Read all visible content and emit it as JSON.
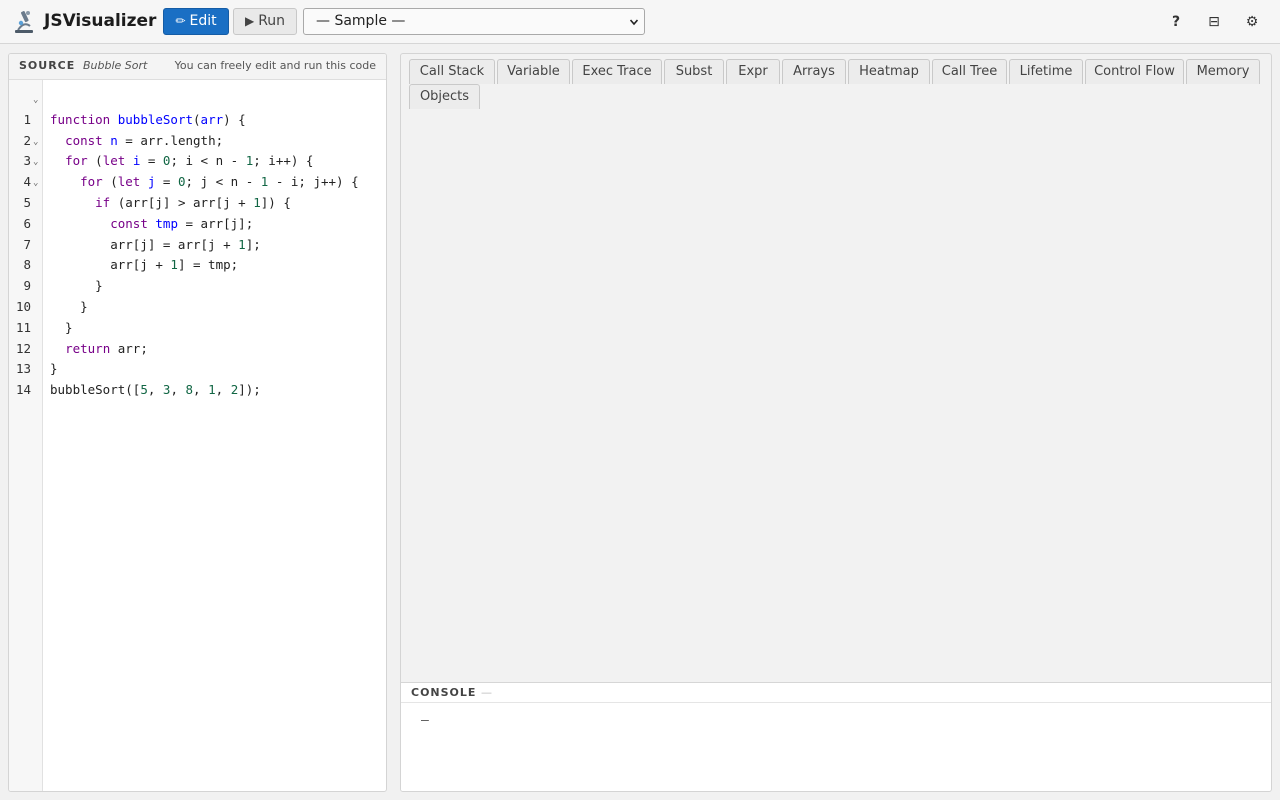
{
  "header": {
    "app_title": "JSVisualizer",
    "edit_label": "Edit",
    "run_label": "Run",
    "sample_selected": "— Sample —",
    "help_label": "?",
    "layout_label": "⊟",
    "settings_label": "⚙"
  },
  "icons": {
    "logo": "microscope-icon",
    "edit": "pencil-icon",
    "run": "play-icon"
  },
  "source": {
    "label": "SOURCE",
    "name": "Bubble Sort",
    "note": "You can freely edit and run this code",
    "lines": [
      {
        "n": "1",
        "fold": true
      },
      {
        "n": "2",
        "fold": false
      },
      {
        "n": "3",
        "fold": true
      },
      {
        "n": "4",
        "fold": true
      },
      {
        "n": "5",
        "fold": true
      },
      {
        "n": "6",
        "fold": false
      },
      {
        "n": "7",
        "fold": false
      },
      {
        "n": "8",
        "fold": false
      },
      {
        "n": "9",
        "fold": false
      },
      {
        "n": "10",
        "fold": false
      },
      {
        "n": "11",
        "fold": false
      },
      {
        "n": "12",
        "fold": false
      },
      {
        "n": "13",
        "fold": false
      },
      {
        "n": "14",
        "fold": false
      }
    ],
    "code": [
      "function bubbleSort(arr) {",
      "  const n = arr.length;",
      "  for (let i = 0; i < n - 1; i++) {",
      "    for (let j = 0; j < n - 1 - i; j++) {",
      "      if (arr[j] > arr[j + 1]) {",
      "        const tmp = arr[j];",
      "        arr[j] = arr[j + 1];",
      "        arr[j + 1] = tmp;",
      "      }",
      "    }",
      "  }",
      "  return arr;",
      "}",
      "bubbleSort([5, 3, 8, 1, 2]);"
    ]
  },
  "tabs": [
    "Call Stack",
    "Variable",
    "Exec Trace",
    "Subst",
    "Expr",
    "Arrays",
    "Heatmap",
    "Call Tree",
    "Lifetime",
    "Control Flow",
    "Memory",
    "Objects"
  ],
  "console": {
    "label": "CONSOLE",
    "dash": "—",
    "output": "—"
  },
  "colors": {
    "accent": "#1a6fc4",
    "keyword": "#770088",
    "definition": "#0000ff",
    "number": "#116644"
  }
}
